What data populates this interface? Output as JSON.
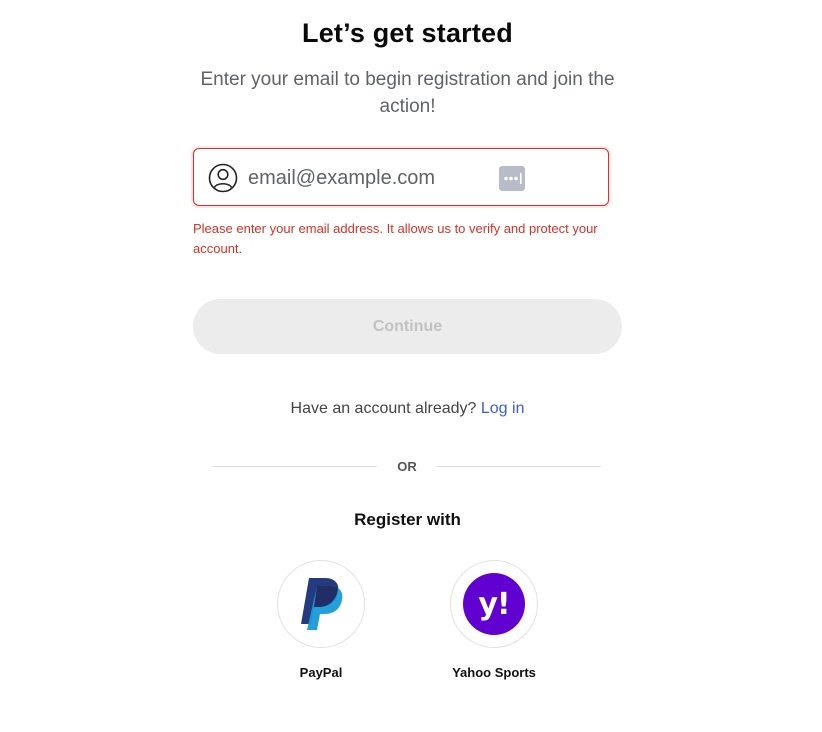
{
  "header": {
    "title": "Let’s get started",
    "subtitle": "Enter your email to begin registration and join the action!"
  },
  "email": {
    "placeholder": "email@example.com",
    "value": "",
    "error": "Please enter your email address. It allows us to verify and protect your account."
  },
  "continue_label": "Continue",
  "login": {
    "prompt": "Have an account already?",
    "link_label": "Log in"
  },
  "divider_label": "OR",
  "register_with_label": "Register with",
  "providers": [
    {
      "label": "PayPal",
      "icon": "paypal-logo"
    },
    {
      "label": "Yahoo Sports",
      "icon": "yahoo-logo"
    }
  ],
  "colors": {
    "error": "#d93025",
    "link": "#3b5bdb",
    "yahoo": "#6001d2",
    "paypal_dark": "#253b80",
    "paypal_light": "#179bd7",
    "button_disabled_bg": "#ececec"
  }
}
